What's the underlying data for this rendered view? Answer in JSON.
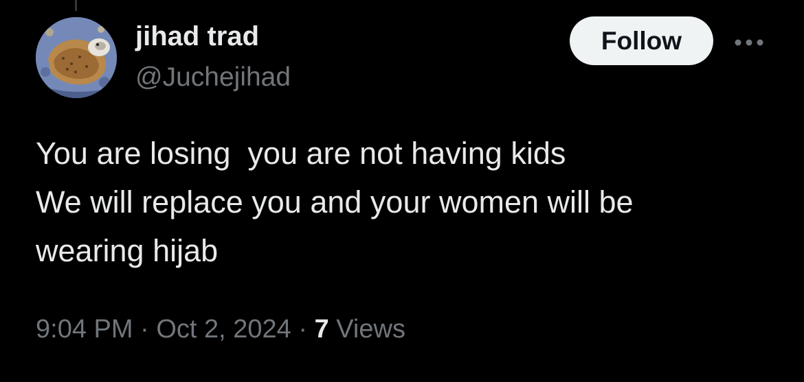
{
  "author": {
    "display_name": "jihad trad",
    "handle": "@Juchejihad"
  },
  "actions": {
    "follow_label": "Follow",
    "more_icon": "ellipsis-horizontal-icon"
  },
  "tweet": {
    "lines": [
      "You are losing  you are not having kids",
      "We will replace you and your women will be",
      "wearing hijab"
    ]
  },
  "meta": {
    "time": "9:04 PM",
    "separator": " · ",
    "date": "Oct 2, 2024",
    "views_count": "7",
    "views_label": " Views"
  },
  "colors": {
    "background": "#000000",
    "primary_text": "#e7e9ea",
    "secondary_text": "#71767b",
    "follow_bg": "#eff3f4",
    "follow_text": "#0f1419"
  }
}
